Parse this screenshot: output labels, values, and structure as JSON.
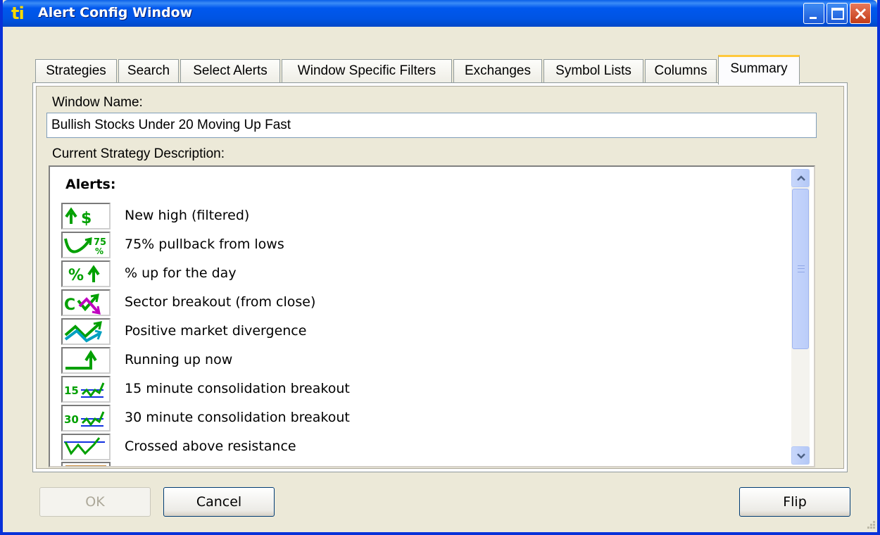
{
  "window": {
    "title": "Alert Config Window",
    "app_icon_text": "ti"
  },
  "tabs": [
    {
      "label": "Strategies"
    },
    {
      "label": "Search"
    },
    {
      "label": "Select Alerts"
    },
    {
      "label": "Window Specific Filters"
    },
    {
      "label": "Exchanges"
    },
    {
      "label": "Symbol Lists"
    },
    {
      "label": "Columns"
    },
    {
      "label": "Summary",
      "active": true
    }
  ],
  "summary": {
    "window_name_label": "Window Name:",
    "window_name_value": "Bullish Stocks Under 20 Moving Up Fast",
    "description_label": "Current Strategy Description:",
    "alerts_heading": "Alerts:",
    "alerts": [
      {
        "icon": "up-dollar-icon",
        "label": "New high (filtered)"
      },
      {
        "icon": "pullback-75-icon",
        "label": "75% pullback from lows"
      },
      {
        "icon": "percent-up-icon",
        "label": "% up for the day"
      },
      {
        "icon": "sector-breakout-icon",
        "label": "Sector breakout (from close)"
      },
      {
        "icon": "market-divergence-icon",
        "label": "Positive market divergence"
      },
      {
        "icon": "running-up-icon",
        "label": "Running up now"
      },
      {
        "icon": "consolidation-15-icon",
        "label": "15 minute consolidation breakout"
      },
      {
        "icon": "consolidation-30-icon",
        "label": "30 minute consolidation breakout"
      },
      {
        "icon": "crossed-resistance-icon",
        "label": "Crossed above resistance"
      }
    ]
  },
  "buttons": {
    "ok": "OK",
    "cancel": "Cancel",
    "flip": "Flip"
  },
  "colors": {
    "titlebar": "#0054e3",
    "alert_icon_green": "#00a000",
    "alert_icon_magenta": "#c000c0",
    "alert_icon_cyan": "#00a0c0",
    "tab_highlight": "#ffc83c"
  }
}
